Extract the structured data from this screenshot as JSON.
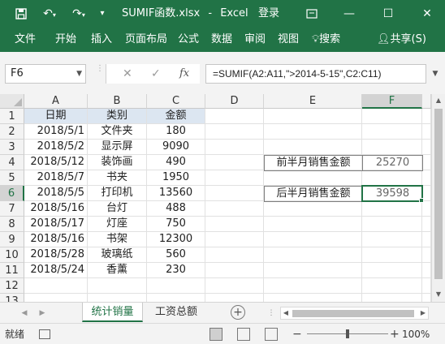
{
  "titlebar": {
    "save_icon": "save-icon",
    "undo_icon": "undo-icon",
    "redo_icon": "redo-icon",
    "customize_icon": "customize-icon",
    "filename": "SUMIF函数.xlsx",
    "separator": "-",
    "app": "Excel",
    "login": "登录",
    "window_buttons": [
      "restore-icon",
      "minimize-icon",
      "maximize-icon",
      "close-icon"
    ]
  },
  "ribbon": {
    "tabs": [
      "文件",
      "开始",
      "插入",
      "页面布局",
      "公式",
      "数据",
      "审阅",
      "视图",
      "搜索"
    ],
    "share": "共享(S)"
  },
  "formula_bar": {
    "name_box": "F6",
    "cancel": "✕",
    "enter": "✓",
    "fx": "fx",
    "formula": "=SUMIF(A2:A11,\">2014-5-15\",C2:C11)"
  },
  "grid": {
    "columns": [
      "A",
      "B",
      "C",
      "D",
      "E",
      "F"
    ],
    "selected_column": "F",
    "rows": [
      "1",
      "2",
      "3",
      "4",
      "5",
      "6",
      "7",
      "8",
      "9",
      "10",
      "11",
      "12",
      "13"
    ],
    "selected_row": "6",
    "header_row": [
      "日期",
      "类别",
      "金额"
    ],
    "data": [
      [
        "2018/5/1",
        "文件夹",
        "180"
      ],
      [
        "2018/5/2",
        "显示屏",
        "9090"
      ],
      [
        "2018/5/12",
        "装饰画",
        "490"
      ],
      [
        "2018/5/7",
        "书夹",
        "1950"
      ],
      [
        "2018/5/5",
        "打印机",
        "13560"
      ],
      [
        "2018/5/16",
        "台灯",
        "488"
      ],
      [
        "2018/5/17",
        "灯座",
        "750"
      ],
      [
        "2018/5/16",
        "书架",
        "12300"
      ],
      [
        "2018/5/28",
        "玻璃纸",
        "560"
      ],
      [
        "2018/5/24",
        "香薰",
        "230"
      ]
    ],
    "summary": [
      {
        "label": "前半月销售金额",
        "value": "25270"
      },
      {
        "label": "后半月销售金额",
        "value": "39598"
      }
    ]
  },
  "sheets": {
    "tabs": [
      "统计销量",
      "工资总额"
    ],
    "active": "统计销量"
  },
  "statusbar": {
    "ready": "就绪",
    "zoom_minus": "−",
    "zoom_plus": "+",
    "zoom": "100%"
  },
  "colors": {
    "accent": "#217346",
    "header_fill": "#dce6f1"
  }
}
